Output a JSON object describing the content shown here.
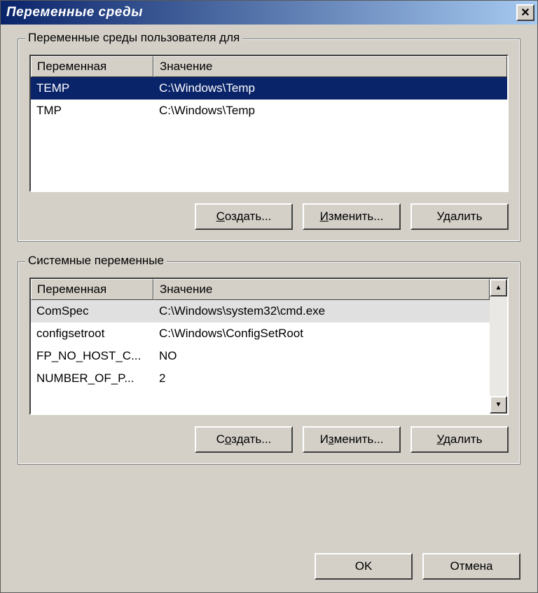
{
  "title": "Переменные среды",
  "user_group": {
    "label": "Переменные среды пользователя для",
    "columns": {
      "var": "Переменная",
      "val": "Значение"
    },
    "rows": [
      {
        "var": "TEMP",
        "val": "C:\\Windows\\Temp",
        "selected": true
      },
      {
        "var": "TMP",
        "val": "C:\\Windows\\Temp"
      }
    ],
    "buttons": {
      "create": "Создать...",
      "edit": "Изменить...",
      "delete": "Удалить"
    }
  },
  "system_group": {
    "label": "Системные переменные",
    "columns": {
      "var": "Переменная",
      "val": "Значение"
    },
    "rows": [
      {
        "var": "ComSpec",
        "val": "C:\\Windows\\system32\\cmd.exe",
        "sysselected": true
      },
      {
        "var": "configsetroot",
        "val": "C:\\Windows\\ConfigSetRoot"
      },
      {
        "var": "FP_NO_HOST_C...",
        "val": "NO"
      },
      {
        "var": "NUMBER_OF_P...",
        "val": "2"
      }
    ],
    "buttons": {
      "create": "Создать...",
      "edit": "Изменить...",
      "delete": "Удалить"
    }
  },
  "footer": {
    "ok": "OK",
    "cancel": "Отмена"
  }
}
